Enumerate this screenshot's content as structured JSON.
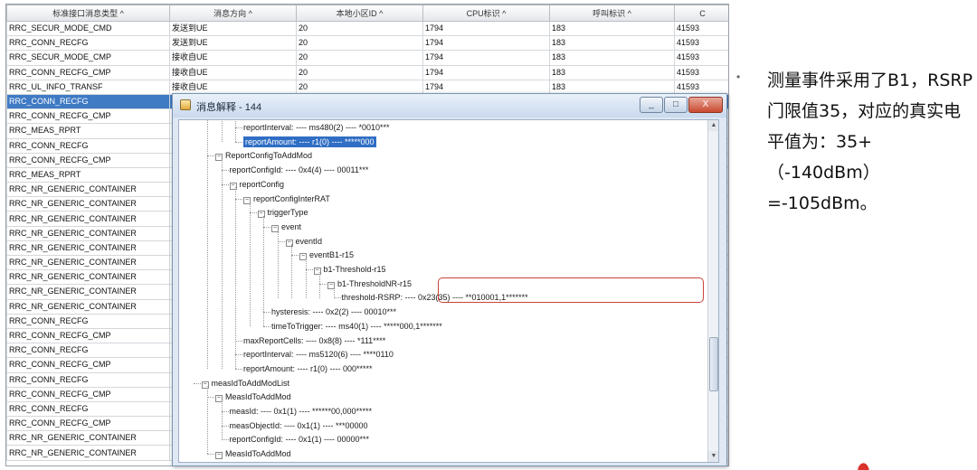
{
  "table": {
    "columns": [
      "标准接口消息类型 ^",
      "消息方向 ^",
      "本地小区ID ^",
      "CPU标识 ^",
      "呼叫标识 ^",
      "C"
    ],
    "rows": [
      [
        "RRC_SECUR_MODE_CMD",
        "发送到UE",
        "20",
        "1794",
        "183",
        "41593"
      ],
      [
        "RRC_CONN_RECFG",
        "发送到UE",
        "20",
        "1794",
        "183",
        "41593"
      ],
      [
        "RRC_SECUR_MODE_CMP",
        "接收自UE",
        "20",
        "1794",
        "183",
        "41593"
      ],
      [
        "RRC_CONN_RECFG_CMP",
        "接收自UE",
        "20",
        "1794",
        "183",
        "41593"
      ],
      [
        "RRC_UL_INFO_TRANSF",
        "接收自UE",
        "20",
        "1794",
        "183",
        "41593"
      ],
      [
        "RRC_CONN_RECFG",
        "",
        "",
        "",
        "",
        ""
      ],
      [
        "RRC_CONN_RECFG_CMP",
        "",
        "",
        "",
        "",
        ""
      ],
      [
        "RRC_MEAS_RPRT",
        "",
        "",
        "",
        "",
        ""
      ],
      [
        "RRC_CONN_RECFG",
        "",
        "",
        "",
        "",
        ""
      ],
      [
        "RRC_CONN_RECFG_CMP",
        "",
        "",
        "",
        "",
        ""
      ],
      [
        "RRC_MEAS_RPRT",
        "",
        "",
        "",
        "",
        ""
      ],
      [
        "RRC_NR_GENERIC_CONTAINER",
        "",
        "",
        "",
        "",
        ""
      ],
      [
        "RRC_NR_GENERIC_CONTAINER",
        "",
        "",
        "",
        "",
        ""
      ],
      [
        "RRC_NR_GENERIC_CONTAINER",
        "",
        "",
        "",
        "",
        ""
      ],
      [
        "RRC_NR_GENERIC_CONTAINER",
        "",
        "",
        "",
        "",
        ""
      ],
      [
        "RRC_NR_GENERIC_CONTAINER",
        "",
        "",
        "",
        "",
        ""
      ],
      [
        "RRC_NR_GENERIC_CONTAINER",
        "",
        "",
        "",
        "",
        ""
      ],
      [
        "RRC_NR_GENERIC_CONTAINER",
        "",
        "",
        "",
        "",
        ""
      ],
      [
        "RRC_NR_GENERIC_CONTAINER",
        "",
        "",
        "",
        "",
        ""
      ],
      [
        "RRC_NR_GENERIC_CONTAINER",
        "",
        "",
        "",
        "",
        ""
      ],
      [
        "RRC_CONN_RECFG",
        "",
        "",
        "",
        "",
        ""
      ],
      [
        "RRC_CONN_RECFG_CMP",
        "",
        "",
        "",
        "",
        ""
      ],
      [
        "RRC_CONN_RECFG",
        "",
        "",
        "",
        "",
        ""
      ],
      [
        "RRC_CONN_RECFG_CMP",
        "",
        "",
        "",
        "",
        ""
      ],
      [
        "RRC_CONN_RECFG",
        "",
        "",
        "",
        "",
        ""
      ],
      [
        "RRC_CONN_RECFG_CMP",
        "",
        "",
        "",
        "",
        ""
      ],
      [
        "RRC_CONN_RECFG",
        "",
        "",
        "",
        "",
        ""
      ],
      [
        "RRC_CONN_RECFG_CMP",
        "",
        "",
        "",
        "",
        ""
      ],
      [
        "RRC_NR_GENERIC_CONTAINER",
        "",
        "",
        "",
        "",
        ""
      ],
      [
        "RRC_NR_GENERIC_CONTAINER",
        "",
        "",
        "",
        "",
        ""
      ]
    ],
    "selected_row": 5
  },
  "dialog": {
    "title": "消息解释 - 144",
    "min_glyph": "_",
    "max_glyph": "□",
    "close_glyph": "X",
    "tree": [
      {
        "text": "reportInterval: ---- ms480(2) ---- *0010***",
        "level": 10,
        "leaf": true
      },
      {
        "text": "reportAmount: ---- r1(0) ---- *****000",
        "level": 10,
        "leaf": true,
        "highlight": true
      },
      {
        "text": "ReportConfigToAddMod",
        "level": 8,
        "leaf": false
      },
      {
        "text": "reportConfigId: ---- 0x4(4) ---- 00011***",
        "level": 9,
        "leaf": true
      },
      {
        "text": "reportConfig",
        "level": 9,
        "leaf": false
      },
      {
        "text": "reportConfigInterRAT",
        "level": 10,
        "leaf": false
      },
      {
        "text": "triggerType",
        "level": 11,
        "leaf": false
      },
      {
        "text": "event",
        "level": 12,
        "leaf": false
      },
      {
        "text": "eventId",
        "level": 13,
        "leaf": false
      },
      {
        "text": "eventB1-r15",
        "level": 14,
        "leaf": false
      },
      {
        "text": "b1-Threshold-r15",
        "level": 15,
        "leaf": false
      },
      {
        "text": "b1-ThresholdNR-r15",
        "level": 16,
        "leaf": false
      },
      {
        "text": "threshold-RSRP: ---- 0x23(35) ---- **010001,1*******",
        "level": 17,
        "leaf": true
      },
      {
        "text": "hysteresis: ---- 0x2(2) ---- 00010***",
        "level": 12,
        "leaf": true
      },
      {
        "text": "timeToTrigger: ---- ms40(1) ---- *****000,1*******",
        "level": 12,
        "leaf": true
      },
      {
        "text": "maxReportCells: ---- 0x8(8) ---- *111****",
        "level": 10,
        "leaf": true
      },
      {
        "text": "reportInterval: ---- ms5120(6) ---- ****0110",
        "level": 10,
        "leaf": true
      },
      {
        "text": "reportAmount: ---- r1(0) ---- 000*****",
        "level": 10,
        "leaf": true
      },
      {
        "text": "measIdToAddModList",
        "level": 7,
        "leaf": false
      },
      {
        "text": "MeasIdToAddMod",
        "level": 8,
        "leaf": false
      },
      {
        "text": "measId: ---- 0x1(1) ---- ******00,000*****",
        "level": 9,
        "leaf": true
      },
      {
        "text": "measObjectId: ---- 0x1(1) ---- ***00000",
        "level": 9,
        "leaf": true
      },
      {
        "text": "reportConfigId: ---- 0x1(1) ---- 00000***",
        "level": 9,
        "leaf": true
      },
      {
        "text": "MeasIdToAddMod",
        "level": 8,
        "leaf": false
      }
    ]
  },
  "note": {
    "bullet": "•",
    "text": "测量事件采用了B1，RSRP门限值35，对应的真实电平值为：35+（-140dBm）=-105dBm。"
  },
  "colors": {
    "selection": "#3f7ac4",
    "highlight_box": "#c9433a",
    "tree_highlight": "#2f6ec4"
  }
}
